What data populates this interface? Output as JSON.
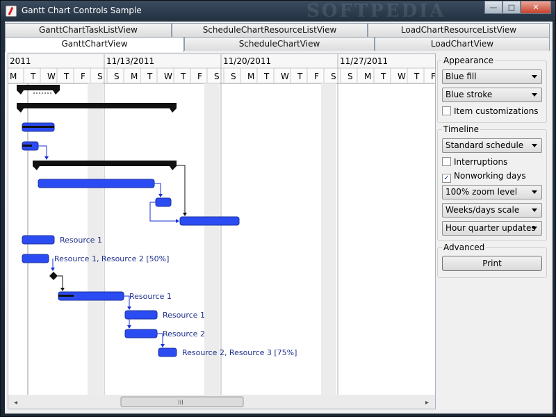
{
  "window": {
    "title": "Gantt Chart Controls Sample",
    "watermark": "SOFTPEDIA",
    "buttons": {
      "minimize": "—",
      "maximize": "□",
      "close": "✕"
    }
  },
  "tabs": {
    "row1": [
      "GanttChartTaskListView",
      "ScheduleChartResourceListView",
      "LoadChartResourceListView"
    ],
    "row2": [
      "GanttChartView",
      "ScheduleChartView",
      "LoadChartView"
    ],
    "active": "GanttChartView"
  },
  "timeline": {
    "weeks": [
      "2011",
      "11/13/2011",
      "11/20/2011",
      "11/27/2011"
    ],
    "days": [
      "M",
      "T",
      "W",
      "T",
      "F",
      "S",
      "S",
      "M",
      "T",
      "W",
      "T",
      "F",
      "S",
      "S",
      "M",
      "T",
      "W",
      "T",
      "F",
      "S",
      "S",
      "M",
      "T",
      "W",
      "T",
      "F",
      "S"
    ]
  },
  "bar_labels": {
    "r1": "Resource 1",
    "r2": "Resource 1, Resource 2 [50%]",
    "r3": "Resource 1",
    "r4": "Resource 1",
    "r5": "Resource 2",
    "r6": "Resource 2, Resource 3 [75%]"
  },
  "panel": {
    "appearance": {
      "title": "Appearance",
      "fill": "Blue fill",
      "stroke": "Blue stroke",
      "item_custom": "Item customizations"
    },
    "timeline": {
      "title": "Timeline",
      "schedule": "Standard schedule",
      "interruptions": "Interruptions",
      "nonworking": "Nonworking days",
      "nonworking_checked": "✓",
      "zoom": "100% zoom level",
      "scale": "Weeks/days scale",
      "updates": "Hour quarter updates"
    },
    "advanced": {
      "title": "Advanced",
      "print": "Print"
    }
  },
  "scrollbar": {
    "left": "◂",
    "right": "▸",
    "grip": "III"
  },
  "colors": {
    "bar_fill": "#2b4cf2",
    "summary": "#111111",
    "weekend": "#ececec",
    "accent": "#1d3f8c"
  }
}
